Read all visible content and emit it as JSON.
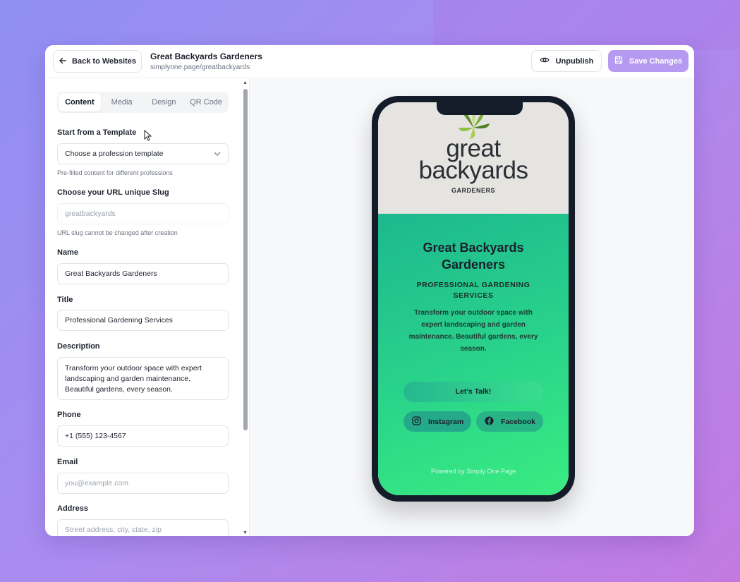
{
  "header": {
    "back_label": "Back to Websites",
    "site_title": "Great Backyards Gardeners",
    "site_url": "simplyone.page/greatbackyards",
    "unpublish_label": "Unpublish",
    "save_label": "Save Changes",
    "colors": {
      "save_bg": "#b69af1"
    }
  },
  "tabs": [
    {
      "label": "Content",
      "active": true
    },
    {
      "label": "Media",
      "active": false
    },
    {
      "label": "Design",
      "active": false
    },
    {
      "label": "QR Code",
      "active": false
    }
  ],
  "form": {
    "template_label": "Start from a Template",
    "template_value": "Choose a profession template",
    "template_hint": "Pre-filled content for different professions",
    "slug_label": "Choose your URL unique Slug",
    "slug_value": "greatbackyards",
    "slug_hint": "URL slug cannot be changed after creation",
    "name_label": "Name",
    "name_value": "Great Backyards Gardeners",
    "title_label": "Title",
    "title_value": "Professional Gardening Services",
    "description_label": "Description",
    "description_value": "Transform your outdoor space with expert landscaping and garden maintenance. Beautiful gardens, every season.",
    "phone_label": "Phone",
    "phone_value": "+1 (555) 123-4567",
    "email_label": "Email",
    "email_placeholder": "you@example.com",
    "address_label": "Address",
    "address_placeholder": "Street address, city, state, zip"
  },
  "preview": {
    "logo_line1": "great",
    "logo_line2": "backyards",
    "logo_line3": "GARDENERS",
    "business_name": "Great Backyards Gardeners",
    "business_title": "PROFESSIONAL GARDENING SERVICES",
    "business_description": "Transform your outdoor space with expert landscaping and garden maintenance. Beautiful gardens, every season.",
    "cta_label": "Let's Talk!",
    "instagram_label": "Instagram",
    "facebook_label": "Facebook",
    "powered_by": "Powered by Simply One Page",
    "colors": {
      "gradient_start": "#1db88f",
      "gradient_end": "#3aec80",
      "logo_bg": "#e5e4e0"
    }
  },
  "icons": [
    "arrow-left-icon",
    "eye-icon",
    "save-icon",
    "chevron-down-icon",
    "instagram-icon",
    "facebook-icon",
    "leaf-logo-icon",
    "cursor-icon"
  ]
}
